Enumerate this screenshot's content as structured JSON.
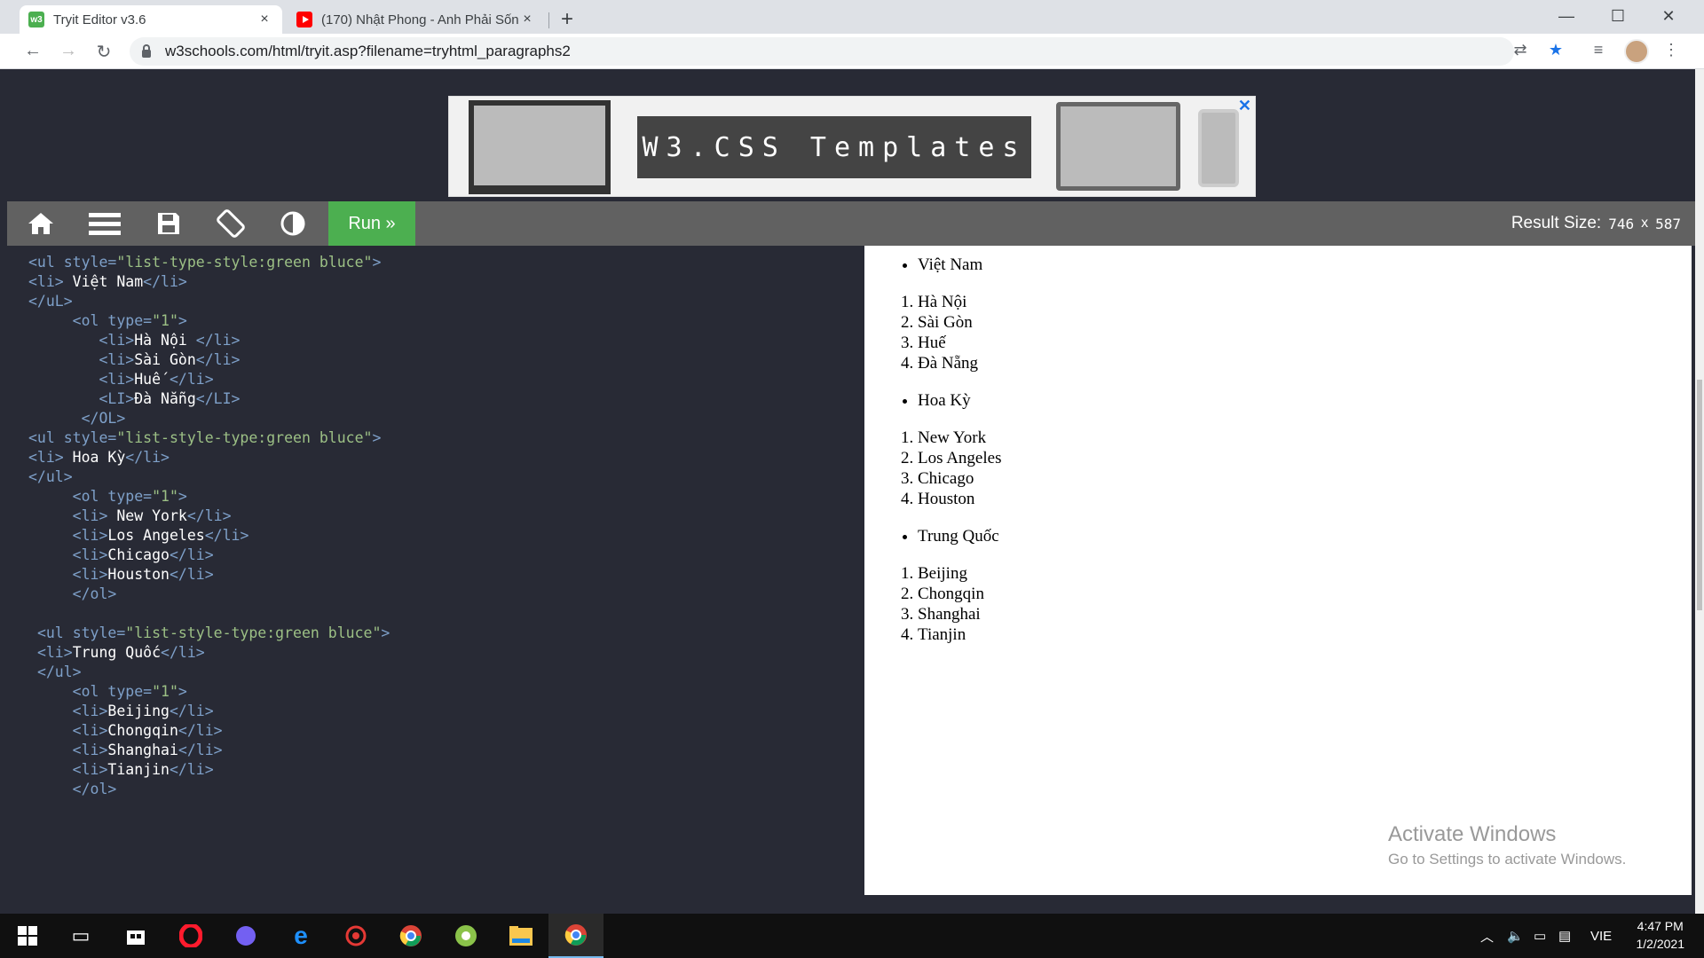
{
  "browser": {
    "tabs": [
      {
        "title": "Tryit Editor v3.6",
        "favicon": "w3",
        "close": "×"
      },
      {
        "title": "(170) Nhật Phong - Anh Phải Sống",
        "favicon": "youtube",
        "close": "×"
      }
    ],
    "new_tab": "+",
    "window_controls": {
      "minimize": "—",
      "maximize": "☐",
      "close": "✕"
    },
    "url": "w3schools.com/html/tryit.asp?filename=tryhtml_paragraphs2"
  },
  "ad": {
    "banner_text": "W3.CSS Templates",
    "close": "✕"
  },
  "editor_toolbar": {
    "run_label": "Run »",
    "result_size_label": "Result Size:",
    "width": "746",
    "times": "x",
    "height": "587"
  },
  "code_lines": [
    {
      "indent": "",
      "parts": [
        [
          "tg",
          "<ul "
        ],
        [
          "at",
          "style="
        ],
        [
          "av",
          "\"list-type-style:green bluce\""
        ],
        [
          "tg",
          ">"
        ]
      ]
    },
    {
      "indent": "",
      "parts": [
        [
          "tg",
          "<li>"
        ],
        [
          "t",
          " Việt Nam"
        ],
        [
          "tg",
          "</li>"
        ]
      ]
    },
    {
      "indent": "",
      "parts": [
        [
          "tg",
          "</uL>"
        ]
      ]
    },
    {
      "indent": "     ",
      "parts": [
        [
          "tg",
          "<ol "
        ],
        [
          "at",
          "type="
        ],
        [
          "av",
          "\"1\""
        ],
        [
          "tg",
          ">"
        ]
      ]
    },
    {
      "indent": "        ",
      "parts": [
        [
          "tg",
          "<li>"
        ],
        [
          "t",
          "Hà Nội "
        ],
        [
          "tg",
          "</li>"
        ]
      ]
    },
    {
      "indent": "        ",
      "parts": [
        [
          "tg",
          "<li>"
        ],
        [
          "t",
          "Sài Gòn"
        ],
        [
          "tg",
          "</li>"
        ]
      ]
    },
    {
      "indent": "        ",
      "parts": [
        [
          "tg",
          "<li>"
        ],
        [
          "t",
          "Huế "
        ],
        [
          "tg",
          "</li>"
        ]
      ]
    },
    {
      "indent": "        ",
      "parts": [
        [
          "tg",
          "<LI>"
        ],
        [
          "t",
          "Đà Nẵng"
        ],
        [
          "tg",
          "</LI>"
        ]
      ]
    },
    {
      "indent": "      ",
      "parts": [
        [
          "tg",
          "</OL>"
        ]
      ]
    },
    {
      "indent": "",
      "parts": [
        [
          "tg",
          "<ul "
        ],
        [
          "at",
          "style="
        ],
        [
          "av",
          "\"list-style-type:green bluce\""
        ],
        [
          "tg",
          ">"
        ]
      ]
    },
    {
      "indent": "",
      "parts": [
        [
          "tg",
          "<li>"
        ],
        [
          "t",
          " Hoa Kỳ"
        ],
        [
          "tg",
          "</li>"
        ]
      ]
    },
    {
      "indent": "",
      "parts": [
        [
          "tg",
          "</ul>"
        ]
      ]
    },
    {
      "indent": "     ",
      "parts": [
        [
          "tg",
          "<ol "
        ],
        [
          "at",
          "type="
        ],
        [
          "av",
          "\"1\""
        ],
        [
          "tg",
          ">"
        ]
      ]
    },
    {
      "indent": "     ",
      "parts": [
        [
          "tg",
          "<li>"
        ],
        [
          "t",
          " New York"
        ],
        [
          "tg",
          "</li>"
        ]
      ]
    },
    {
      "indent": "     ",
      "parts": [
        [
          "tg",
          "<li>"
        ],
        [
          "t",
          "Los Angeles"
        ],
        [
          "tg",
          "</li>"
        ]
      ]
    },
    {
      "indent": "     ",
      "parts": [
        [
          "tg",
          "<li>"
        ],
        [
          "t",
          "Chicago"
        ],
        [
          "tg",
          "</li>"
        ]
      ]
    },
    {
      "indent": "     ",
      "parts": [
        [
          "tg",
          "<li>"
        ],
        [
          "t",
          "Houston"
        ],
        [
          "tg",
          "</li>"
        ]
      ]
    },
    {
      "indent": "     ",
      "parts": [
        [
          "tg",
          "</ol>"
        ]
      ]
    },
    {
      "indent": "",
      "parts": []
    },
    {
      "indent": " ",
      "parts": [
        [
          "tg",
          "<ul "
        ],
        [
          "at",
          "style="
        ],
        [
          "av",
          "\"list-style-type:green bluce\""
        ],
        [
          "tg",
          ">"
        ]
      ]
    },
    {
      "indent": " ",
      "parts": [
        [
          "tg",
          "<li>"
        ],
        [
          "t",
          "Trung Quốc"
        ],
        [
          "tg",
          "</li>"
        ]
      ]
    },
    {
      "indent": " ",
      "parts": [
        [
          "tg",
          "</ul>"
        ]
      ]
    },
    {
      "indent": "     ",
      "parts": [
        [
          "tg",
          "<ol "
        ],
        [
          "at",
          "type="
        ],
        [
          "av",
          "\"1\""
        ],
        [
          "tg",
          ">"
        ]
      ]
    },
    {
      "indent": "     ",
      "parts": [
        [
          "tg",
          "<li>"
        ],
        [
          "t",
          "Beijing"
        ],
        [
          "tg",
          "</li>"
        ]
      ]
    },
    {
      "indent": "     ",
      "parts": [
        [
          "tg",
          "<li>"
        ],
        [
          "t",
          "Chongqin"
        ],
        [
          "tg",
          "</li>"
        ]
      ]
    },
    {
      "indent": "     ",
      "parts": [
        [
          "tg",
          "<li>"
        ],
        [
          "t",
          "Shanghai"
        ],
        [
          "tg",
          "</li>"
        ]
      ]
    },
    {
      "indent": "     ",
      "parts": [
        [
          "tg",
          "<li>"
        ],
        [
          "t",
          "Tianjin"
        ],
        [
          "tg",
          "</li>"
        ]
      ]
    },
    {
      "indent": "     ",
      "parts": [
        [
          "tg",
          "</ol>"
        ]
      ]
    }
  ],
  "result": {
    "groups": [
      {
        "bullet": "Việt Nam",
        "items": [
          "Hà Nội",
          "Sài Gòn",
          "Huế",
          "Đà Nẵng"
        ]
      },
      {
        "bullet": "Hoa Kỳ",
        "items": [
          "New York",
          "Los Angeles",
          "Chicago",
          "Houston"
        ]
      },
      {
        "bullet": "Trung Quốc",
        "items": [
          "Beijing",
          "Chongqin",
          "Shanghai",
          "Tianjin"
        ]
      }
    ],
    "watermark": {
      "title": "Activate Windows",
      "subtitle": "Go to Settings to activate Windows."
    }
  },
  "taskbar": {
    "language": "VIE",
    "time": "4:47 PM",
    "date": "1/2/2021"
  },
  "colors": {
    "run_green": "#4CAF50",
    "editor_bg": "#282A35",
    "toolbar_gray": "#616161"
  }
}
